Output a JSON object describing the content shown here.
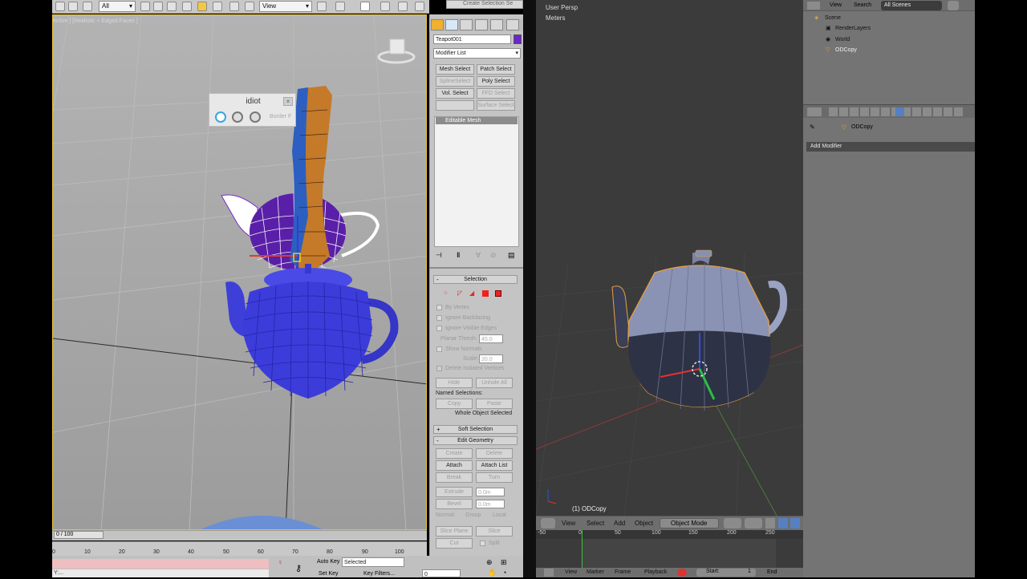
{
  "max": {
    "toolbar": {
      "filter_value": "All",
      "view_value": "View",
      "create_selection": "Create Selection Se"
    },
    "viewport_label": "ective ] [Realistic + Edged Faces ]",
    "idiot_panel": {
      "title": "idiot",
      "close": "×",
      "mode_label": "Border F"
    },
    "command_panel": {
      "object_name": "Teapot001",
      "object_color": "#6a28c8",
      "modifier_list": "Modifier List",
      "modifier_buttons": [
        "Mesh Select",
        "Patch Select",
        "SplineSelect",
        "Poly Select",
        "Vol. Select",
        "FFD Select",
        "",
        "Surface Select"
      ],
      "stack_item": "Editable Mesh",
      "rollouts": {
        "selection": "Selection",
        "soft_selection": "Soft Selection",
        "edit_geometry": "Edit Geometry"
      },
      "selection_options": {
        "by_vertex": "By Vertex",
        "ignore_backfacing": "Ignore Backfacing",
        "ignore_visible_edges": "Ignore Visible Edges",
        "planar_thresh_label": "Planar Thresh:",
        "planar_thresh_value": "45.0",
        "show_normals": "Show Normals",
        "scale_label": "Scale:",
        "scale_value": "20.0",
        "delete_isolated": "Delete Isolated Vertices",
        "hide": "Hide",
        "unhide_all": "Unhide All",
        "named_selections": "Named Selections:",
        "copy": "Copy",
        "paste": "Paste",
        "status": "Whole Object Selected"
      },
      "edit_geometry": {
        "create": "Create",
        "delete": "Delete",
        "attach": "Attach",
        "attach_list": "Attach List",
        "break": "Break",
        "turn": "Turn",
        "extrude": "Extrude",
        "extrude_value": "0.0m",
        "bevel": "Bevel",
        "bevel_value": "0.0m",
        "normal": "Normal:",
        "group": "Group",
        "local": "Local",
        "slice_plane": "Slice Plane",
        "slice": "Slice",
        "cut": "Cut",
        "split": "Split"
      }
    },
    "time": {
      "slider": "0 / 100",
      "ticks": [
        "0",
        "10",
        "20",
        "30",
        "40",
        "50",
        "60",
        "70",
        "80",
        "90",
        "100"
      ]
    },
    "bottom": {
      "auto_key": "Auto Key",
      "set_key": "Set Key",
      "selected": "Selected",
      "key_filters": "Key Filters...",
      "frame": "0",
      "status_left": "Y:..."
    }
  },
  "blender": {
    "viewport": {
      "persp": "User Persp",
      "units": "Meters",
      "object_label": "(1) ODCopy"
    },
    "header": {
      "menus": [
        "View",
        "Select",
        "Add",
        "Object"
      ],
      "mode": "Object Mode"
    },
    "timeline_ticks": [
      "0",
      "50",
      "100",
      "150",
      "200",
      "250"
    ],
    "timeline_left": "-50",
    "bottom": {
      "menus": [
        "View",
        "Marker",
        "Frame",
        "Playback"
      ],
      "start_label": "Start:",
      "start_value": "1",
      "end_label": "End"
    },
    "outliner": {
      "view": "View",
      "search": "Search",
      "scenes": "All Scenes",
      "rows": [
        "Scene",
        "RenderLayers",
        "World",
        "ODCopy"
      ]
    },
    "properties": {
      "breadcrumb": "ODCopy",
      "add_modifier": "Add Modifier"
    }
  }
}
